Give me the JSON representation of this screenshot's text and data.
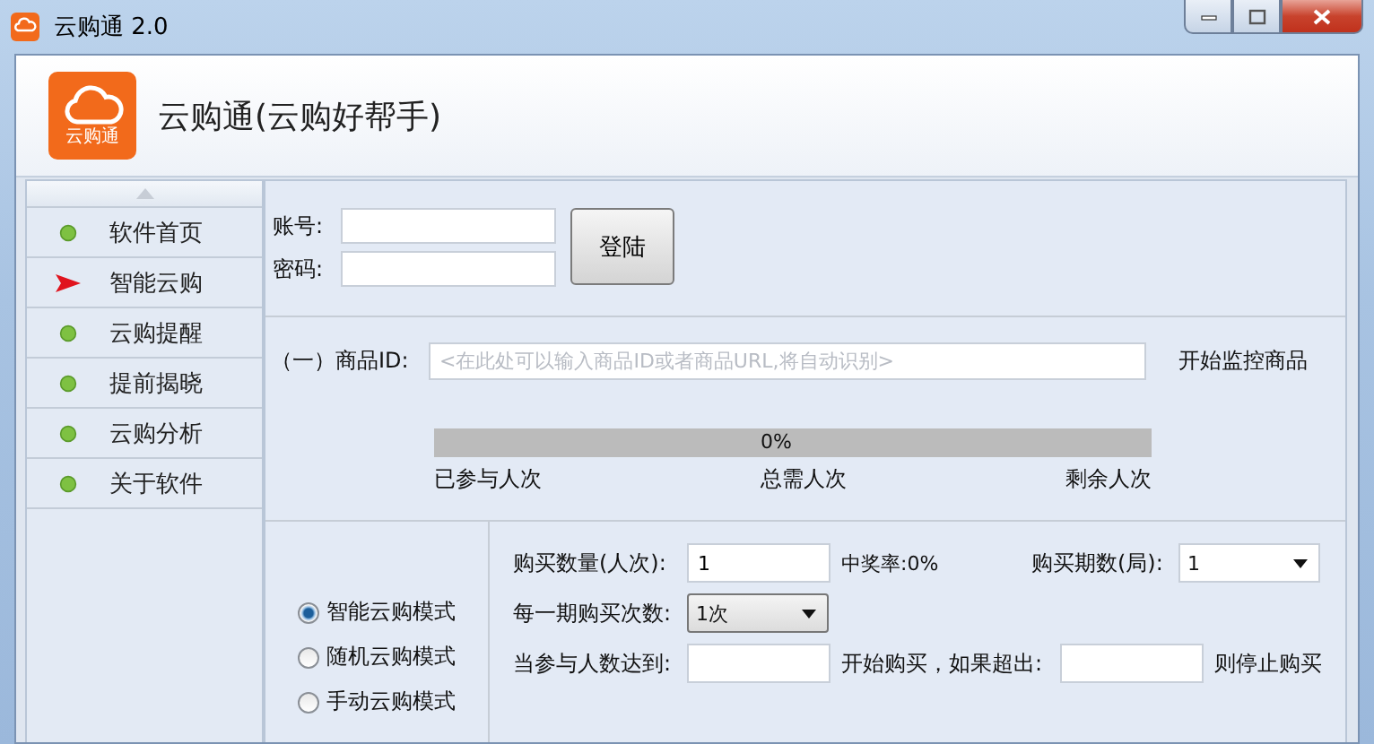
{
  "window": {
    "title": "云购通 2.0"
  },
  "header": {
    "logo_text": "云购通",
    "title": "云购通(云购好帮手)"
  },
  "sidebar": {
    "items": [
      {
        "label": "软件首页",
        "selected": false
      },
      {
        "label": "智能云购",
        "selected": true
      },
      {
        "label": "云购提醒",
        "selected": false
      },
      {
        "label": "提前揭晓",
        "selected": false
      },
      {
        "label": "云购分析",
        "selected": false
      },
      {
        "label": "关于软件",
        "selected": false
      }
    ]
  },
  "login": {
    "account_label": "账号:",
    "password_label": "密码:",
    "button": "登陆"
  },
  "product": {
    "label": "（一）商品ID:",
    "placeholder": "<在此处可以输入商品ID或者商品URL,将自动识别>",
    "action": "开始监控商品",
    "progress": {
      "level": 0,
      "reading": "0%"
    },
    "stats": [
      "已参与人次",
      "总需人次",
      "剩余人次"
    ]
  },
  "modes": [
    {
      "label": "智能云购模式",
      "selected": true
    },
    {
      "label": "随机云购模式",
      "selected": false
    },
    {
      "label": "手动云购模式",
      "selected": false
    }
  ],
  "settings": {
    "quantity": {
      "label": "购买数量(人次):",
      "value": "1"
    },
    "win_rate": "中奖率:0%",
    "periods": {
      "label": "购买期数(局):",
      "value": "1"
    },
    "times": {
      "label": "每一期购买次数:",
      "value": "1次"
    },
    "threshold": {
      "label": "当参与人数达到:",
      "middle": "开始购买，如果超出:",
      "end": "则停止购买"
    }
  }
}
